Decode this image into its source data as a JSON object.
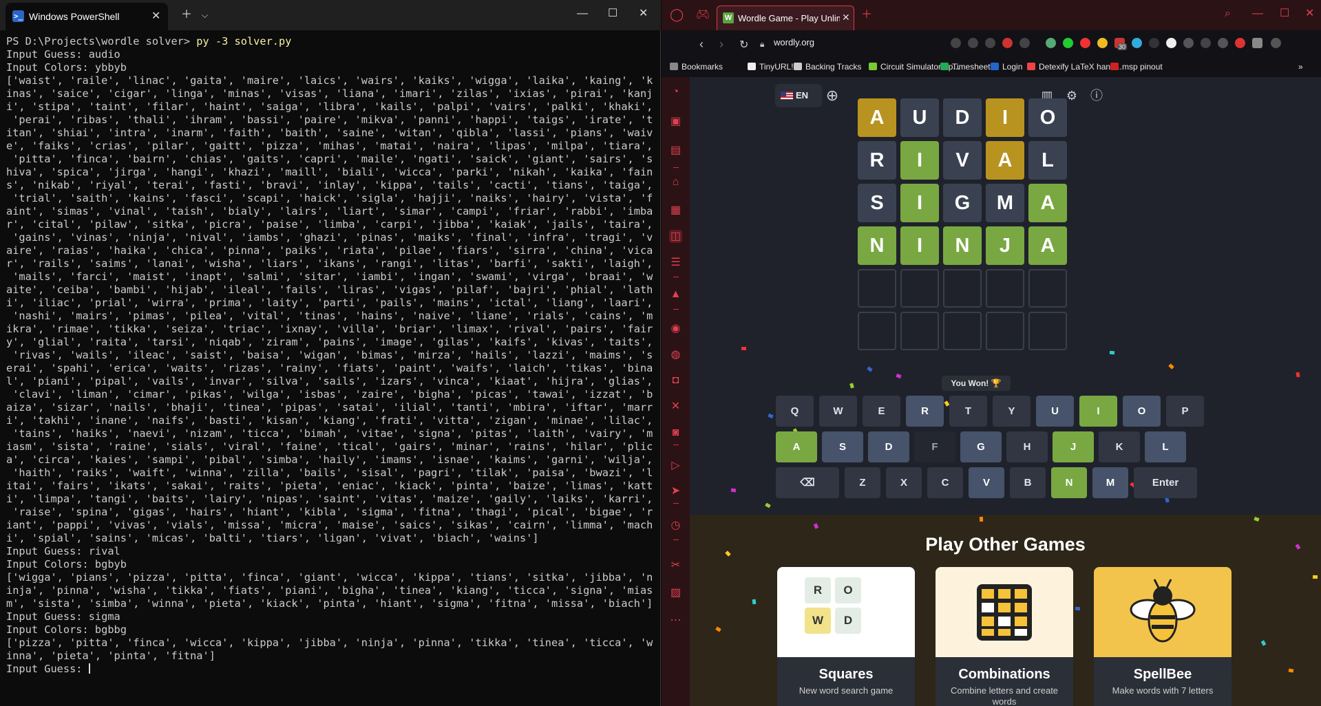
{
  "powershell": {
    "tab_title": "Windows PowerShell",
    "prompt": "PS D:\\Projects\\wordle solver> ",
    "command": "py -3 solver.py",
    "session": [
      "Input Guess: audio",
      "Input Colors: ybbyb",
      "['waist', 'raile', 'linac', 'gaita', 'maire', 'laics', 'wairs', 'kaiks', 'wigga', 'laika', 'kaing', 'k",
      "inas', 'saice', 'cigar', 'linga', 'minas', 'visas', 'liana', 'imari', 'zilas', 'ixias', 'pirai', 'kanj",
      "i', 'stipa', 'taint', 'filar', 'haint', 'saiga', 'libra', 'kails', 'palpi', 'vairs', 'palki', 'khaki',",
      " 'perai', 'ribas', 'thali', 'ihram', 'bassi', 'paire', 'mikva', 'panni', 'happi', 'taigs', 'irate', 't",
      "itan', 'shiai', 'intra', 'inarm', 'faith', 'baith', 'saine', 'witan', 'qibla', 'lassi', 'pians', 'waiv",
      "e', 'faiks', 'crias', 'pilar', 'gaitt', 'pizza', 'mihas', 'matai', 'naira', 'lipas', 'milpa', 'tiara',",
      " 'pitta', 'finca', 'bairn', 'chias', 'gaits', 'capri', 'maile', 'ngati', 'saick', 'giant', 'sairs', 's",
      "hiva', 'spica', 'jirga', 'hangi', 'khazi', 'maill', 'biali', 'wicca', 'parki', 'nikah', 'kaika', 'fain",
      "s', 'nikab', 'riyal', 'terai', 'fasti', 'bravi', 'inlay', 'kippa', 'tails', 'cacti', 'tians', 'taiga',",
      " 'trial', 'saith', 'kains', 'fasci', 'scapi', 'haick', 'sigla', 'hajji', 'naiks', 'hairy', 'vista', 'f",
      "aint', 'simas', 'vinal', 'taish', 'bialy', 'lairs', 'liart', 'simar', 'campi', 'friar', 'rabbi', 'imba",
      "r', 'cital', 'pilaw', 'sitka', 'picra', 'paise', 'limba', 'carpi', 'jibba', 'kaiak', 'jails', 'taira',",
      " 'gains', 'vinas', 'ninja', 'nival', 'iambs', 'ghazi', 'pinas', 'maiks', 'final', 'infra', 'tragi', 'v",
      "aire', 'raias', 'haika', 'chica', 'pinna', 'paiks', 'riata', 'pilae', 'fiars', 'sirra', 'china', 'vica",
      "r', 'rails', 'saims', 'lanai', 'wisha', 'liars', 'ikans', 'rangi', 'litas', 'barfi', 'sakti', 'laigh',",
      " 'mails', 'farci', 'maist', 'inapt', 'salmi', 'sitar', 'iambi', 'ingan', 'swami', 'virga', 'braai', 'w",
      "aite', 'ceiba', 'bambi', 'hijab', 'ileal', 'fails', 'liras', 'vigas', 'pilaf', 'bajri', 'phial', 'lath",
      "i', 'iliac', 'prial', 'wirra', 'prima', 'laity', 'parti', 'pails', 'mains', 'ictal', 'liang', 'laari',",
      " 'nashi', 'mairs', 'pimas', 'pilea', 'vital', 'tinas', 'hains', 'naive', 'liane', 'rials', 'cains', 'm",
      "ikra', 'rimae', 'tikka', 'seiza', 'triac', 'ixnay', 'villa', 'briar', 'limax', 'rival', 'pairs', 'fair",
      "y', 'glial', 'raita', 'tarsi', 'niqab', 'ziram', 'pains', 'image', 'gilas', 'kaifs', 'kivas', 'taits',",
      " 'rivas', 'wails', 'ileac', 'saist', 'baisa', 'wigan', 'bimas', 'mirza', 'hails', 'lazzi', 'maims', 's",
      "erai', 'spahi', 'erica', 'waits', 'rizas', 'rainy', 'fiats', 'paint', 'waifs', 'laich', 'tikas', 'bina",
      "l', 'piani', 'pipal', 'vails', 'invar', 'silva', 'sails', 'izars', 'vinca', 'kiaat', 'hijra', 'glias',",
      " 'clavi', 'liman', 'cimar', 'pikas', 'wilga', 'isbas', 'zaire', 'bigha', 'picas', 'tawai', 'izzat', 'b",
      "aiza', 'sizar', 'nails', 'bhaji', 'tinea', 'pipas', 'satai', 'ilial', 'tanti', 'mbira', 'iftar', 'marr",
      "i', 'takhi', 'inane', 'naifs', 'basti', 'kisan', 'kiang', 'frati', 'vitta', 'zigan', 'minae', 'lilac',",
      " 'tains', 'haiks', 'naevi', 'nizam', 'ticca', 'bimah', 'vitae', 'signa', 'pitas', 'laith', 'vairy', 'm",
      "iasm', 'sista', 'raine', 'sials', 'viral', 'faine', 'tical', 'gairs', 'minar', 'rains', 'hilar', 'plic",
      "a', 'circa', 'kaies', 'sampi', 'pibal', 'simba', 'haily', 'imams', 'isnae', 'kaims', 'garni', 'wilja',",
      " 'haith', 'raiks', 'waift', 'winna', 'zilla', 'bails', 'sisal', 'pagri', 'tilak', 'paisa', 'bwazi', 'l",
      "itai', 'fairs', 'ikats', 'sakai', 'raits', 'pieta', 'eniac', 'kiack', 'pinta', 'baize', 'limas', 'katt",
      "i', 'limpa', 'tangi', 'baits', 'lairy', 'nipas', 'saint', 'vitas', 'maize', 'gaily', 'laiks', 'karri',",
      " 'raise', 'spina', 'gigas', 'hairs', 'hiant', 'kibla', 'sigma', 'fitna', 'thagi', 'pical', 'bigae', 'r",
      "iant', 'pappi', 'vivas', 'vials', 'missa', 'micra', 'maise', 'saics', 'sikas', 'cairn', 'limma', 'mach",
      "i', 'spial', 'sains', 'micas', 'balti', 'tiars', 'ligan', 'vivat', 'biach', 'wains']",
      "Input Guess: rival",
      "Input Colors: bgbyb",
      "['wigga', 'pians', 'pizza', 'pitta', 'finca', 'giant', 'wicca', 'kippa', 'tians', 'sitka', 'jibba', 'n",
      "inja', 'pinna', 'wisha', 'tikka', 'fiats', 'piani', 'bigha', 'tinea', 'kiang', 'ticca', 'signa', 'mias",
      "m', 'sista', 'simba', 'winna', 'pieta', 'kiack', 'pinta', 'hiant', 'sigma', 'fitna', 'missa', 'biach']",
      "Input Guess: sigma",
      "Input Colors: bgbbg",
      "['pizza', 'pitta', 'finca', 'wicca', 'kippa', 'jibba', 'ninja', 'pinna', 'tikka', 'tinea', 'ticca', 'w",
      "inna', 'pieta', 'pinta', 'fitna']"
    ],
    "final_prompt": "Input Guess: "
  },
  "browser": {
    "tab_title": "Wordle Game - Play Unlimited",
    "favicon": "W",
    "url": "wordly.org",
    "extension_badge": "30",
    "bookmarks": [
      "Bookmarks",
      "TinyURL!",
      "Backing Tracks",
      "Circuit Simulator Ap...",
      "Timesheet",
      "Login",
      "Detexify LaTeX hand...",
      "msp pinout"
    ],
    "page": {
      "language": "EN",
      "board": [
        {
          "letters": [
            "A",
            "U",
            "D",
            "I",
            "O"
          ],
          "states": [
            "y",
            "b",
            "b",
            "y",
            "b"
          ]
        },
        {
          "letters": [
            "R",
            "I",
            "V",
            "A",
            "L"
          ],
          "states": [
            "b",
            "g",
            "b",
            "y",
            "b"
          ]
        },
        {
          "letters": [
            "S",
            "I",
            "G",
            "M",
            "A"
          ],
          "states": [
            "b",
            "g",
            "b",
            "b",
            "g"
          ]
        },
        {
          "letters": [
            "N",
            "I",
            "N",
            "J",
            "A"
          ],
          "states": [
            "g",
            "g",
            "g",
            "g",
            "g"
          ]
        },
        {
          "letters": [
            "",
            "",
            "",
            "",
            ""
          ],
          "states": [
            "e",
            "e",
            "e",
            "e",
            "e"
          ]
        },
        {
          "letters": [
            "",
            "",
            "",
            "",
            ""
          ],
          "states": [
            "e",
            "e",
            "e",
            "e",
            "e"
          ]
        }
      ],
      "status": "You Won! 🏆",
      "keyboard": [
        [
          {
            "k": "Q",
            "s": ""
          },
          {
            "k": "W",
            "s": ""
          },
          {
            "k": "E",
            "s": ""
          },
          {
            "k": "R",
            "s": "b"
          },
          {
            "k": "T",
            "s": ""
          },
          {
            "k": "Y",
            "s": ""
          },
          {
            "k": "U",
            "s": "b"
          },
          {
            "k": "I",
            "s": "g"
          },
          {
            "k": "O",
            "s": "b"
          },
          {
            "k": "P",
            "s": ""
          }
        ],
        [
          {
            "k": "A",
            "s": "g"
          },
          {
            "k": "S",
            "s": "b"
          },
          {
            "k": "D",
            "s": "b"
          },
          {
            "k": "F",
            "s": "d"
          },
          {
            "k": "G",
            "s": "b"
          },
          {
            "k": "H",
            "s": ""
          },
          {
            "k": "J",
            "s": "g"
          },
          {
            "k": "K",
            "s": ""
          },
          {
            "k": "L",
            "s": "b"
          }
        ],
        [
          {
            "k": "⌫",
            "s": ""
          },
          {
            "k": "Z",
            "s": ""
          },
          {
            "k": "X",
            "s": ""
          },
          {
            "k": "C",
            "s": ""
          },
          {
            "k": "V",
            "s": "b"
          },
          {
            "k": "B",
            "s": ""
          },
          {
            "k": "N",
            "s": "g"
          },
          {
            "k": "M",
            "s": "b"
          },
          {
            "k": "Enter",
            "s": ""
          }
        ]
      ],
      "other_games_heading": "Play Other Games",
      "games": [
        {
          "title": "Squares",
          "subtitle": "New word search game"
        },
        {
          "title": "Combinations",
          "subtitle": "Combine letters and create words"
        },
        {
          "title": "SpellBee",
          "subtitle": "Make words with 7 letters"
        }
      ],
      "squares_tiles": [
        "R",
        "O",
        "W",
        "D"
      ]
    }
  },
  "colors": {
    "green": "#79a842",
    "yellow": "#b99320",
    "gray": "#3a4252",
    "accent": "#e03b46"
  }
}
